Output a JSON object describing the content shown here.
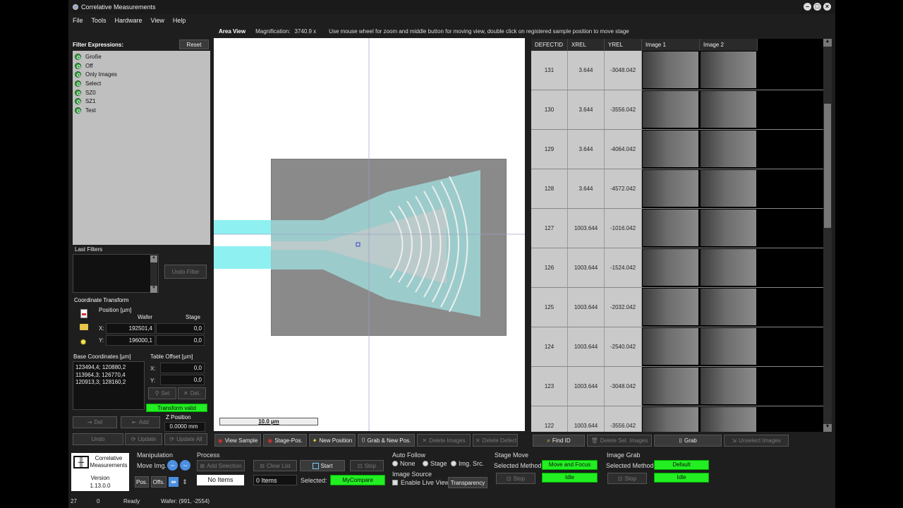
{
  "window": {
    "title": "Correlative Measurements"
  },
  "menu": [
    "File",
    "Tools",
    "Hardware",
    "View",
    "Help"
  ],
  "infobar": {
    "view_label": "Area View",
    "magnification_label": "Magnification:",
    "magnification_value": "3740.9 x",
    "hint": "Use mouse wheel for zoom and middle button for moving view, double click on registered sample position to move stage"
  },
  "filters": {
    "label": "Filter Expressions:",
    "reset": "Reset",
    "items": [
      "Große",
      "Off",
      "Only Images",
      "Select",
      "SZ0",
      "SZ1",
      "Test"
    ]
  },
  "last_filters": {
    "label": "Last Filters",
    "undo": "Undo Filter"
  },
  "coord": {
    "label": "Coordinate Transform",
    "position_label": "Position [µm]",
    "col_wafer": "Wafer",
    "col_stage": "Stage",
    "x_label": "X:",
    "y_label": "Y:",
    "x_wafer": "192501,4",
    "x_stage": "0,0",
    "y_wafer": "196000,1",
    "y_stage": "0,0",
    "base_label": "Base Coordinates [µm]",
    "base_list": [
      "123494,4; 120880,2",
      "113964,3; 126770,4",
      "120913,3; 128160,2"
    ],
    "offset_label": "Table Offset [µm]",
    "off_x": "0,0",
    "off_y": "0,0",
    "set": "Set",
    "del": "Del.",
    "valid": "Transform valid",
    "del2": "Del",
    "add": "Add",
    "zpos_label": "Z Position",
    "zpos": "0.0000 mm",
    "undo": "Undo",
    "update": "Update",
    "update_all": "Update All"
  },
  "scalebar": "10.0 µm",
  "view_buttons": [
    "View Sample",
    "Stage-Pos.",
    "New Position",
    "Grab & New Pos.",
    "Delete Images",
    "Delete Defect"
  ],
  "table": {
    "headers": [
      "DEFECTID",
      "XREL",
      "YREL",
      "Image 1",
      "Image 2"
    ],
    "rows": [
      [
        "131",
        "3.644",
        "-3048.042"
      ],
      [
        "130",
        "3.644",
        "-3556.042"
      ],
      [
        "129",
        "3.644",
        "-4064.042"
      ],
      [
        "128",
        "3.644",
        "-4572.042"
      ],
      [
        "127",
        "1003.644",
        "-1016.042"
      ],
      [
        "126",
        "1003.644",
        "-1524.042"
      ],
      [
        "125",
        "1003.644",
        "-2032.042"
      ],
      [
        "124",
        "1003.644",
        "-2540.042"
      ],
      [
        "123",
        "1003.644",
        "-3048.042"
      ],
      [
        "122",
        "1003.644",
        "-3556.042"
      ]
    ]
  },
  "table_buttons": [
    "Find ID",
    "Delete Sel. Images",
    "Grab",
    "Unselect Images"
  ],
  "bottom": {
    "logo_title": "Correlative Measurements",
    "version_label": "Version",
    "version": "1.13.0.0",
    "manipulation": "Manipulation",
    "move_img": "Move Img.",
    "pos": "Pos.",
    "offs": "Offs.",
    "process": "Process",
    "add_selection": "Add Selection",
    "clear_list": "Clear List",
    "start": "Start",
    "stop": "Stop",
    "no_items": "No Items",
    "items": "0 Items",
    "selected_label": "Selected:",
    "selected_value": "MyCompare",
    "auto_follow": "Auto Follow",
    "af_none": "None",
    "af_stage": "Stage",
    "af_img": "Img. Src.",
    "image_source": "Image Source",
    "enable_live": "Enable Live View",
    "transparency": "Transparency",
    "stage_move": "Stage Move",
    "sm_method_label": "Selected Method:",
    "sm_method": "Move and Focus",
    "sm_stop": "Stop",
    "sm_state": "Idle",
    "image_grab": "Image Grab",
    "ig_method_label": "Selected Method:",
    "ig_method": "Default",
    "ig_stop": "Stop",
    "ig_state": "Idle"
  },
  "status": {
    "count": "27",
    "zero": "0",
    "state": "Ready",
    "wafer": "Wafer: (991, -2554)"
  }
}
